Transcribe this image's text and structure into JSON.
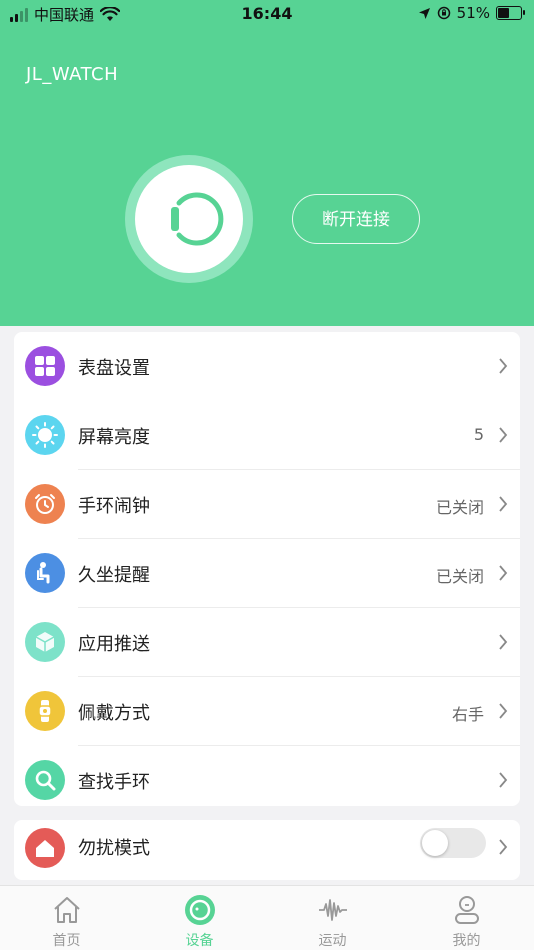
{
  "status_bar": {
    "carrier": "中国联通",
    "time": "16:44",
    "battery": "51%"
  },
  "header": {
    "device_name": "JL_WATCH",
    "disconnect_label": "断开连接"
  },
  "menu": [
    {
      "label": "表盘设置",
      "value": "",
      "icon": "watch-face-grid-icon",
      "color": "#9b4fe0"
    },
    {
      "label": "屏幕亮度",
      "value": "5",
      "icon": "brightness-sun-icon",
      "color": "#5cd5ef"
    },
    {
      "label": "手环闹钟",
      "value": "已关闭",
      "icon": "alarm-clock-icon",
      "color": "#ee8250"
    },
    {
      "label": "久坐提醒",
      "value": "已关闭",
      "icon": "sedentary-person-icon",
      "color": "#4c8fe3"
    },
    {
      "label": "应用推送",
      "value": "",
      "icon": "app-push-cube-icon",
      "color": "#7de2c9"
    },
    {
      "label": "佩戴方式",
      "value": "右手",
      "icon": "wrist-watch-icon",
      "color": "#f0c53a"
    },
    {
      "label": "查找手环",
      "value": "",
      "icon": "search-magnifier-icon",
      "color": "#55d6a5"
    }
  ],
  "second_row": {
    "label": "勿扰模式",
    "icon": "do-not-disturb-home-icon",
    "color": "#e45b57",
    "toggle_on": false
  },
  "tabs": [
    {
      "label": "首页",
      "icon": "home-icon",
      "active": false
    },
    {
      "label": "设备",
      "icon": "device-icon",
      "active": true
    },
    {
      "label": "运动",
      "icon": "activity-wave-icon",
      "active": false
    },
    {
      "label": "我的",
      "icon": "profile-icon",
      "active": false
    }
  ],
  "colors": {
    "accent": "#57d394",
    "background": "#f2f2f4"
  }
}
